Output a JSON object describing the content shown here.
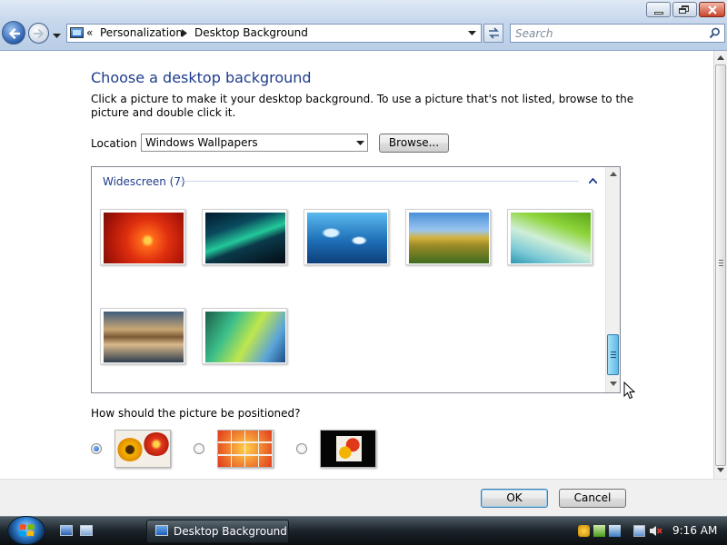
{
  "window": {
    "breadcrumb_prefix": "«",
    "breadcrumb": [
      "Personalization",
      "Desktop Background"
    ],
    "search_placeholder": "Search"
  },
  "page": {
    "title": "Choose a desktop background",
    "description": "Click a picture to make it your desktop background. To use a picture that's not listed, browse to the picture and double click it.",
    "location_label": "Location",
    "location_value": "Windows Wallpapers",
    "browse_label": "Browse...",
    "group_title": "Widescreen (7)",
    "wallpapers": [
      {
        "name": "red-flower"
      },
      {
        "name": "aurora"
      },
      {
        "name": "fish"
      },
      {
        "name": "landscape"
      },
      {
        "name": "palm-frond"
      },
      {
        "name": "lake-mountain"
      },
      {
        "name": "vista-aurora"
      }
    ],
    "position_question": "How should the picture be positioned?",
    "position_options": [
      {
        "name": "fit-to-screen",
        "selected": true
      },
      {
        "name": "tile",
        "selected": false
      },
      {
        "name": "center",
        "selected": false
      }
    ],
    "ok_label": "OK",
    "cancel_label": "Cancel"
  },
  "taskbar": {
    "window_button": "Desktop Background",
    "clock": "9:16 AM"
  },
  "colors": {
    "title_blue": "#1e3c8c",
    "group_blue": "#1e3c8c",
    "taskbar_dark": "#1b2329"
  }
}
